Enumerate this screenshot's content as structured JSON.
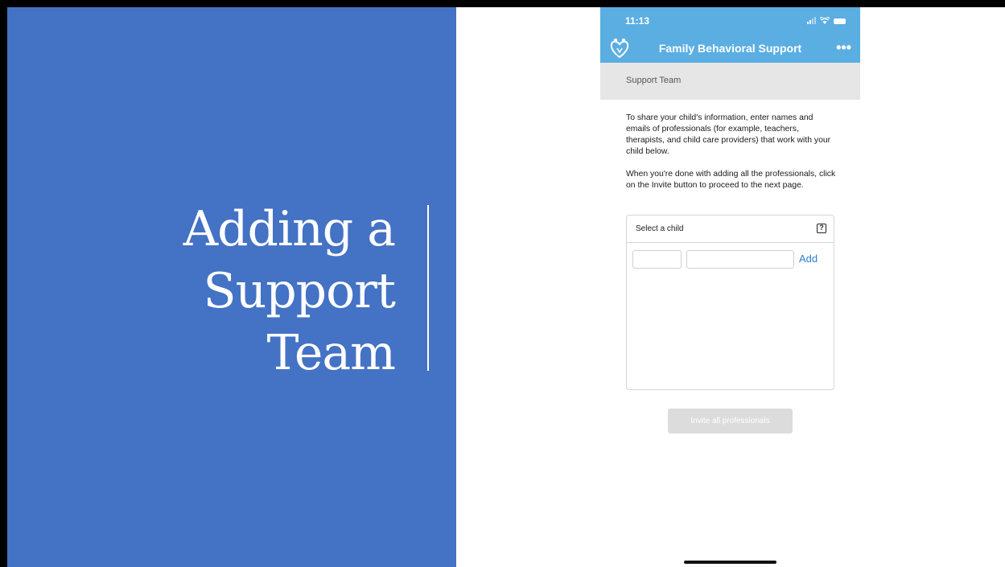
{
  "slide": {
    "title_lines": [
      "Adding a",
      "Support",
      "Team"
    ],
    "background_color": "#4472c4"
  },
  "phone": {
    "status_bar": {
      "time": "11:13",
      "icons": [
        "signal-icon",
        "wifi-icon",
        "battery-icon"
      ]
    },
    "nav": {
      "logo_icon": "family-heart-logo-icon",
      "title": "Family Behavioral Support",
      "more_label": "•••",
      "bar_color": "#5aaee2"
    },
    "section_header": "Support Team",
    "instructions": [
      "To share your child's information, enter names and emails of professionals (for example, teachers, therapists, and child care providers) that work with your child below.",
      "When you're done with adding all the professionals, click on the Invite button to proceed to the next page."
    ],
    "form": {
      "child_select_label": "Select a child",
      "help_icon_label": "?",
      "name_value": "",
      "email_value": "",
      "add_label": "Add",
      "add_color": "#2b7fd0"
    },
    "invite_button_label": "Invite all professionals"
  }
}
